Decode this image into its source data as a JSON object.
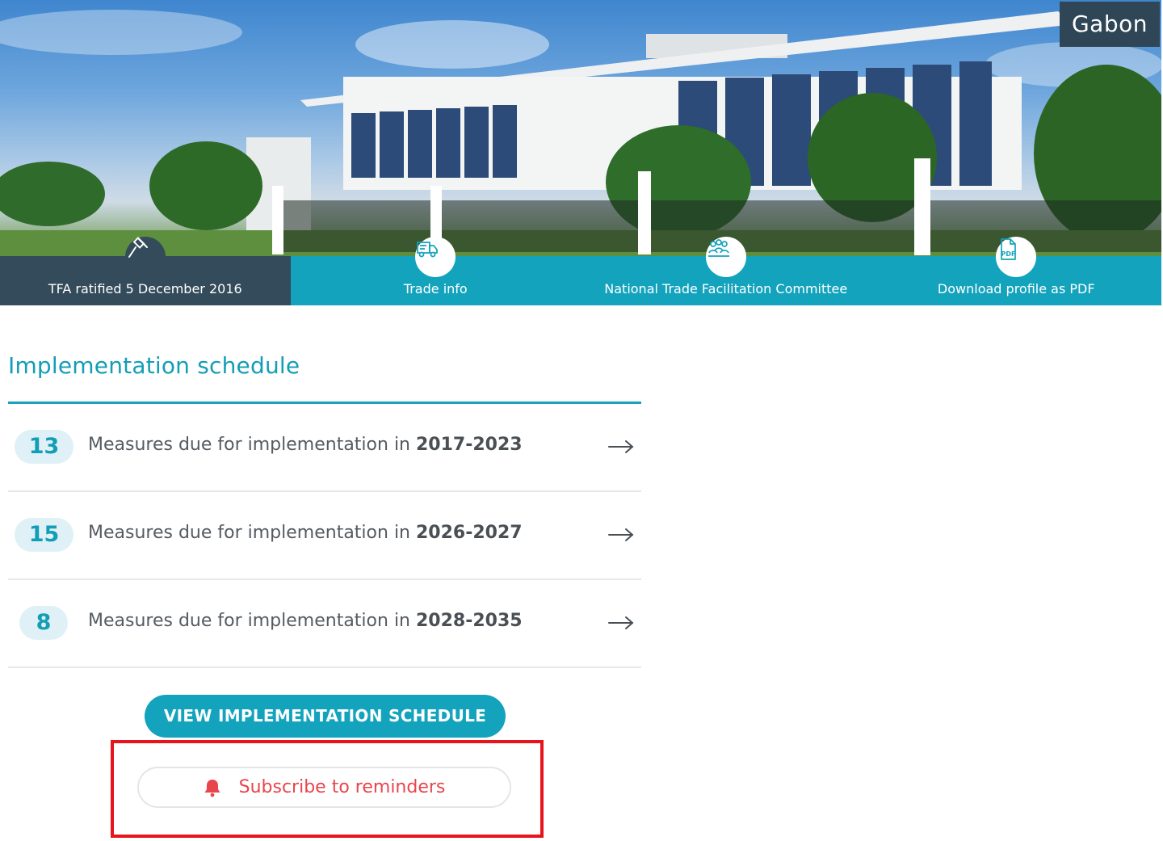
{
  "hero": {
    "country": "Gabon",
    "tabs": [
      {
        "label": "TFA ratified 5 December 2016",
        "icon": "gavel-icon",
        "active": true
      },
      {
        "label": "Trade info",
        "icon": "truck-icon",
        "active": false
      },
      {
        "label": "National Trade Facilitation Committee",
        "icon": "people-icon",
        "active": false
      },
      {
        "label": "Download profile as PDF",
        "icon": "pdf-icon",
        "active": false
      }
    ]
  },
  "schedule": {
    "title": "Implementation schedule",
    "rows": [
      {
        "count": "13",
        "text": "Measures due for implementation in ",
        "period": "2017-2023"
      },
      {
        "count": "15",
        "text": "Measures due for implementation in ",
        "period": "2026-2027"
      },
      {
        "count": "8",
        "text": "Measures due for implementation in ",
        "period": "2028-2035"
      }
    ],
    "view_button": "VIEW IMPLEMENTATION SCHEDULE",
    "subscribe_button": "Subscribe to reminders"
  },
  "colors": {
    "accent": "#14a3bd",
    "dark_tab": "#334b5a",
    "subscribe": "#e8454c",
    "highlight": "#e8141b"
  }
}
